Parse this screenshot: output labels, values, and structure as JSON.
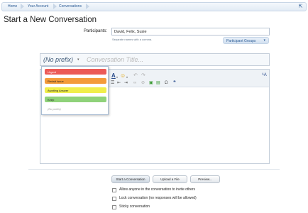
{
  "breadcrumb": {
    "items": [
      "Home",
      "Your Account",
      "Conversations"
    ]
  },
  "page": {
    "title": "Start a New Conversation"
  },
  "participants": {
    "label": "Participants:",
    "value": "David, Felix, Susie",
    "hint": "Separate names with a comma.",
    "groups_button": "Participant Groups"
  },
  "title_row": {
    "prefix": "(No prefix)",
    "placeholder": "Conversation Title..."
  },
  "prefix_menu": {
    "items": [
      "Urgent",
      "Revisit Issue",
      "Awaiting Answer",
      "Keep",
      "(No prefix)"
    ],
    "colors": [
      "#ec5a57",
      "#f49b3a",
      "#f0ee4b",
      "#8fd27a"
    ]
  },
  "actions": {
    "start": "Start a Conversation",
    "upload": "Upload a File",
    "preview": "Preview..."
  },
  "options": {
    "invite": "Allow anyone in the conversation to invite others",
    "lock": "Lock conversation (no responses will be allowed)",
    "sticky": "Sticky conversation"
  },
  "icons": {
    "jump": "jump-up-icon",
    "smilies": "smiley-icon"
  }
}
